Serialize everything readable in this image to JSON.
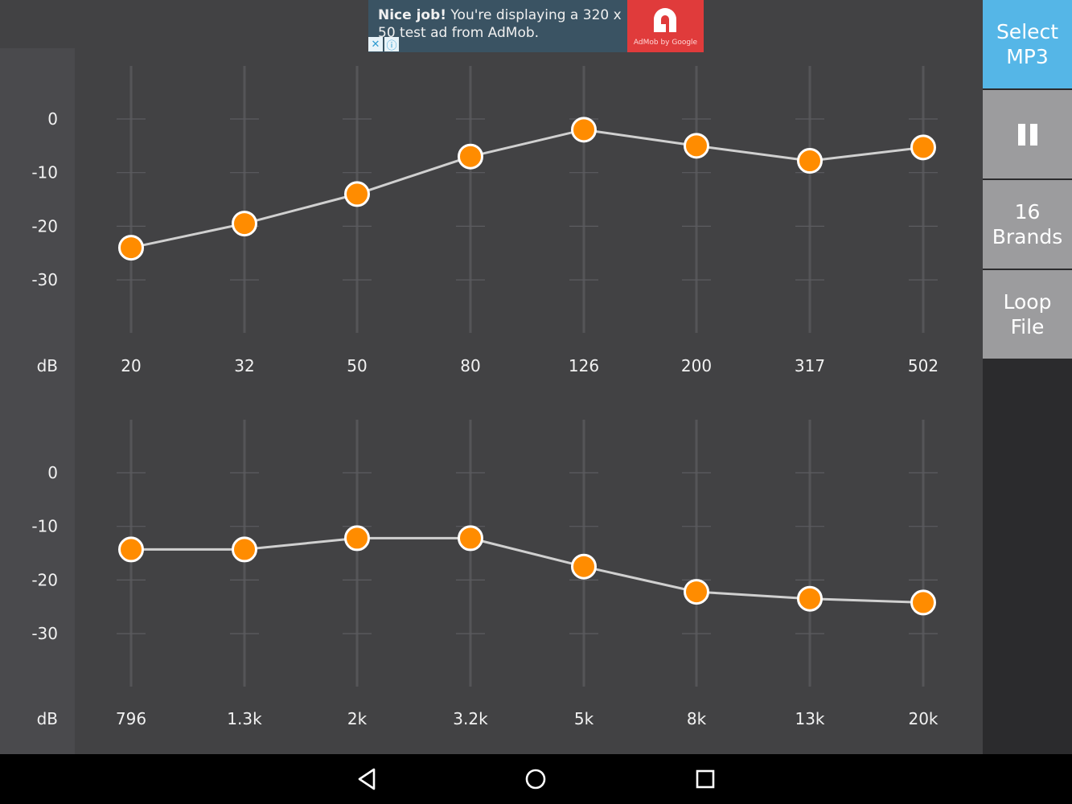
{
  "ad": {
    "headline": "Nice job!",
    "body": " You're displaying a 320 x 50 test ad from AdMob.",
    "logo_caption": "AdMob by Google",
    "close_glyph": "✕",
    "info_glyph": "ⓘ"
  },
  "side_panel": {
    "select_label": "Select\nMP3",
    "pause_icon": "pause-icon",
    "brands_label": "16\nBrands",
    "loop_label": "Loop\nFile"
  },
  "equalizer": {
    "db_ticks": [
      "0",
      "-10",
      "-20",
      "-30"
    ],
    "db_unit": "dB",
    "top_bank": {
      "bands": [
        "20",
        "32",
        "50",
        "80",
        "126",
        "200",
        "317",
        "502"
      ],
      "gains_db": [
        -24,
        -19.5,
        -14,
        -7,
        -2,
        -5,
        -7.8,
        -5.3
      ]
    },
    "bottom_bank": {
      "bands": [
        "796",
        "1.3k",
        "2k",
        "3.2k",
        "5k",
        "8k",
        "13k",
        "20k"
      ],
      "gains_db": [
        -14.3,
        -14.3,
        -12.2,
        -12.2,
        -17.5,
        -22.2,
        -23.5,
        -24.2
      ]
    }
  },
  "colors": {
    "background": "#424244",
    "curve": "#d0d0d0",
    "handle_fill": "#ff8c00",
    "handle_stroke": "#ffffff",
    "accent_button": "#55b6e7",
    "grey_button": "#9c9c9e"
  },
  "nav": {
    "back_icon": "back-triangle-icon",
    "home_icon": "home-circle-icon",
    "recents_icon": "recents-square-icon"
  }
}
